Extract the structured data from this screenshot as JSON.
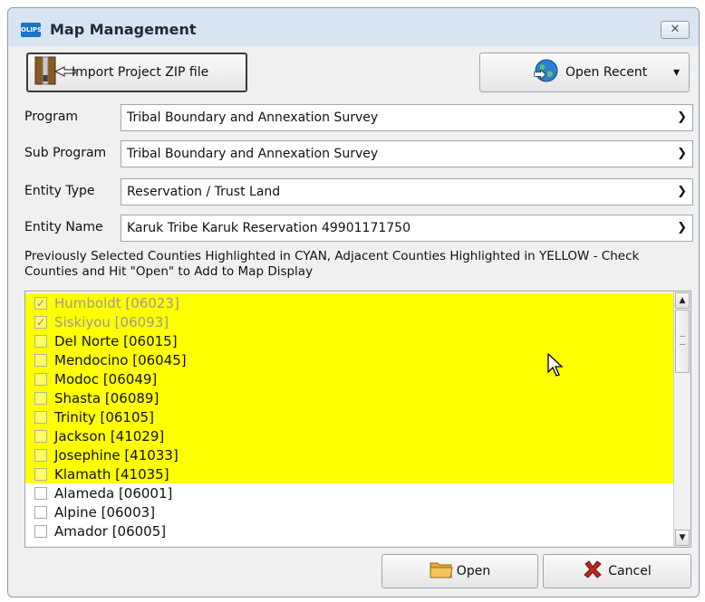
{
  "window": {
    "title": "Map Management",
    "app_icon_text": "OLIPS",
    "close_symbol": "✕"
  },
  "toolbar": {
    "import_label": "Import Project ZIP file",
    "recent_label": "Open Recent",
    "recent_arrow": "▾"
  },
  "fields": {
    "program": {
      "label": "Program",
      "value": "Tribal Boundary and Annexation Survey"
    },
    "sub_program": {
      "label": "Sub Program",
      "value": "Tribal Boundary and Annexation Survey"
    },
    "entity_type": {
      "label": "Entity Type",
      "value": "Reservation / Trust Land"
    },
    "entity_name": {
      "label": "Entity Name",
      "value": "Karuk Tribe Karuk Reservation 49901171750"
    }
  },
  "info_text": "Previously Selected Counties Highlighted in CYAN, Adjacent Counties Highlighted in YELLOW - Check Counties and Hit \"Open\" to Add to Map Display",
  "counties": [
    {
      "name": "Humboldt [06023]",
      "checked": true,
      "highlight": "yellow"
    },
    {
      "name": "Siskiyou [06093]",
      "checked": true,
      "highlight": "yellow"
    },
    {
      "name": "Del Norte [06015]",
      "checked": false,
      "highlight": "yellow"
    },
    {
      "name": "Mendocino [06045]",
      "checked": false,
      "highlight": "yellow"
    },
    {
      "name": "Modoc [06049]",
      "checked": false,
      "highlight": "yellow"
    },
    {
      "name": "Shasta [06089]",
      "checked": false,
      "highlight": "yellow"
    },
    {
      "name": "Trinity [06105]",
      "checked": false,
      "highlight": "yellow"
    },
    {
      "name": "Jackson [41029]",
      "checked": false,
      "highlight": "yellow"
    },
    {
      "name": "Josephine [41033]",
      "checked": false,
      "highlight": "yellow"
    },
    {
      "name": "Klamath [41035]",
      "checked": false,
      "highlight": "yellow"
    },
    {
      "name": "Alameda [06001]",
      "checked": false,
      "highlight": "none"
    },
    {
      "name": "Alpine [06003]",
      "checked": false,
      "highlight": "none"
    },
    {
      "name": "Amador [06005]",
      "checked": false,
      "highlight": "none"
    }
  ],
  "footer": {
    "open_label": "Open",
    "cancel_label": "Cancel"
  },
  "colors": {
    "highlight_yellow": "#ffff00",
    "title_bg": "#d9e4f1"
  }
}
